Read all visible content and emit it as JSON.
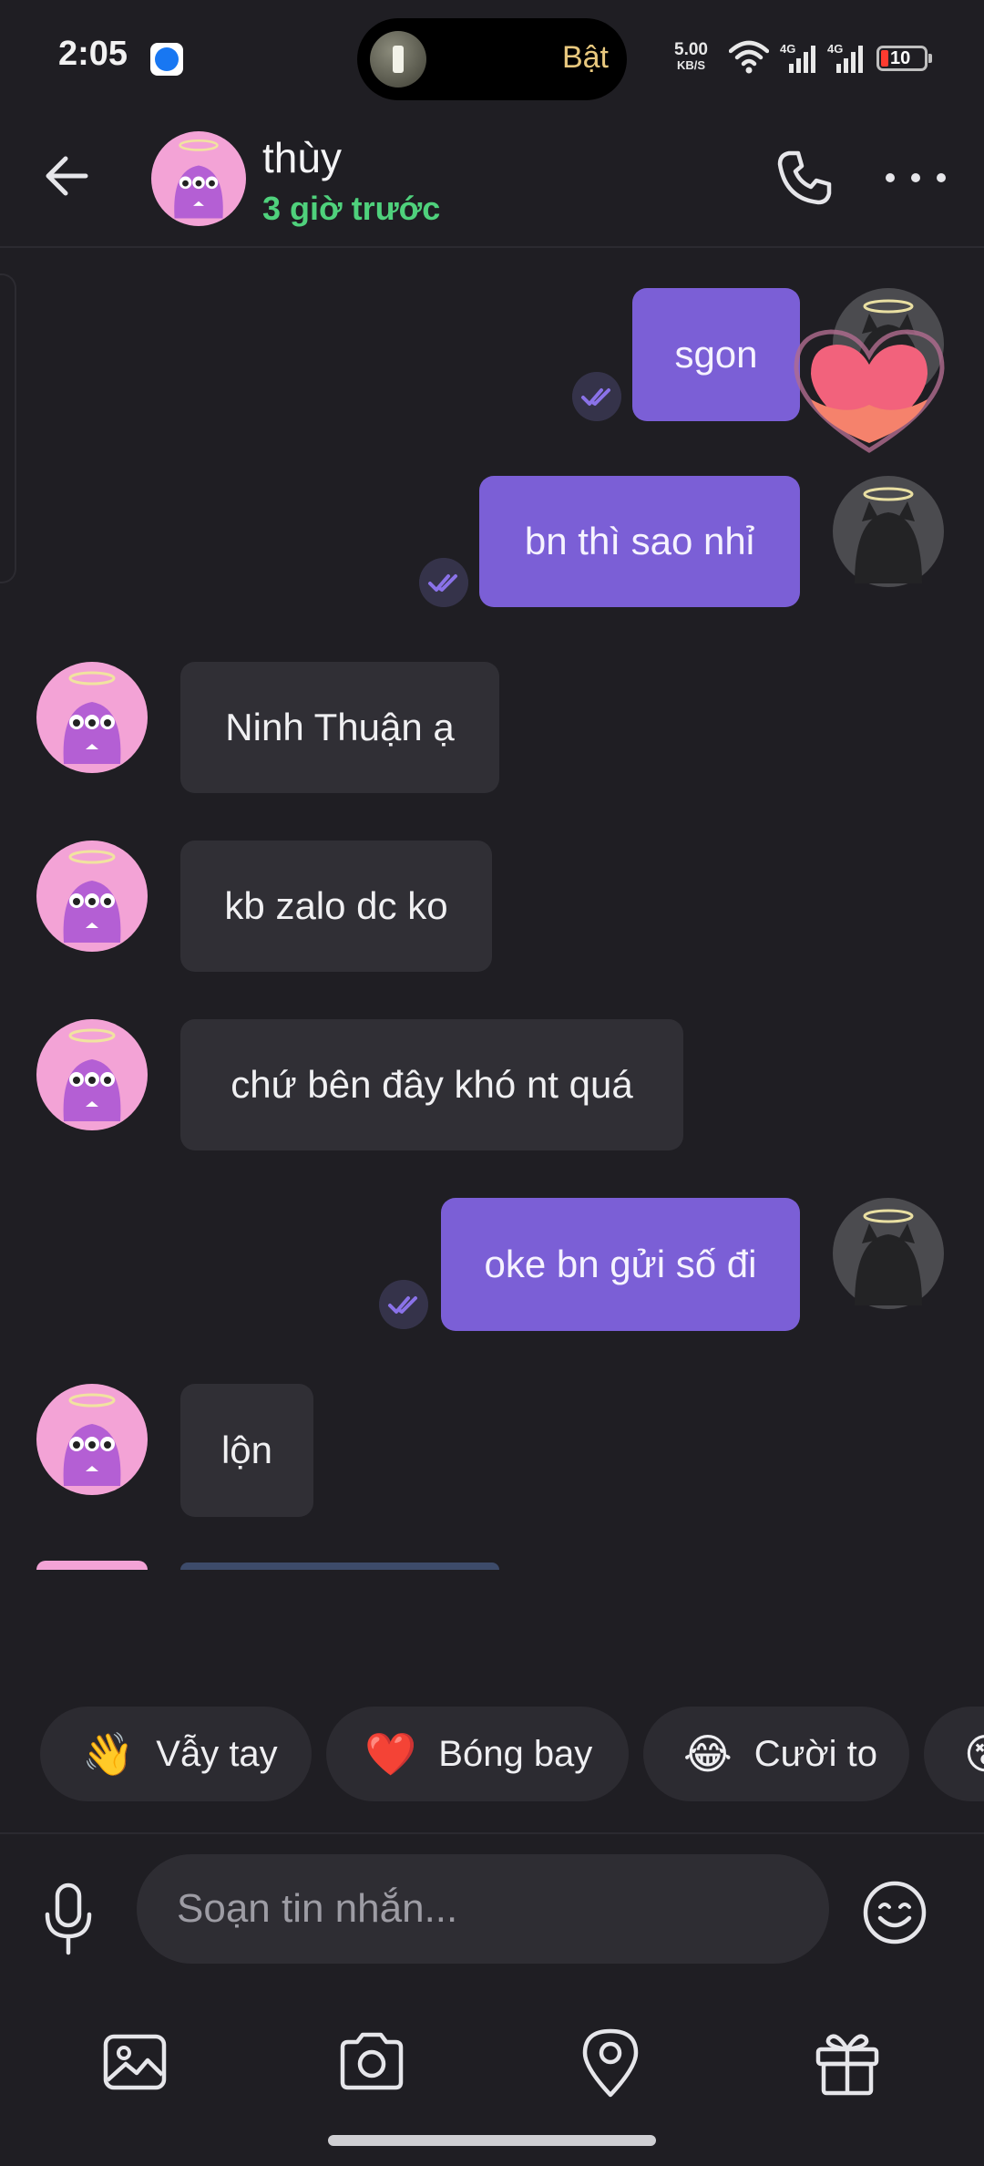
{
  "status_bar": {
    "time": "2:05",
    "island_label": "Bật",
    "net_speed": "5.00",
    "net_unit": "KB/S",
    "network_1": "4G",
    "network_2": "4G",
    "battery": "10"
  },
  "header": {
    "name": "thùy",
    "status": "3 giờ trước"
  },
  "messages": [
    {
      "dir": "out",
      "text": "sgon"
    },
    {
      "dir": "out",
      "text": "bn thì sao nhỉ"
    },
    {
      "dir": "in",
      "text": "Ninh Thuận ạ"
    },
    {
      "dir": "in",
      "text": "kb zalo dc ko"
    },
    {
      "dir": "in",
      "text": "chứ bên đây khó nt quá"
    },
    {
      "dir": "out",
      "text": "oke bn gửi số đi"
    },
    {
      "dir": "in",
      "text": "lộn"
    }
  ],
  "quick_reactions": [
    {
      "emoji": "👋",
      "label": "Vẫy tay"
    },
    {
      "emoji": "❤️",
      "label": "Bóng bay"
    },
    {
      "emoji": "😂",
      "label": "Cười to"
    },
    {
      "emoji": "😵",
      "label": ""
    }
  ],
  "composer": {
    "placeholder": "Soạn tin nhắn..."
  },
  "colors": {
    "background": "#1f1e23",
    "outgoing_bubble": "#7b5fd6",
    "incoming_bubble": "#302f35",
    "status_online": "#4fd17c"
  },
  "icons": {
    "back": "arrow-left-icon",
    "call": "phone-icon",
    "more": "more-horizontal-icon",
    "mic": "microphone-icon",
    "emoji": "smiley-icon",
    "gallery": "image-icon",
    "camera": "camera-icon",
    "location": "map-pin-icon",
    "gift": "gift-icon"
  }
}
